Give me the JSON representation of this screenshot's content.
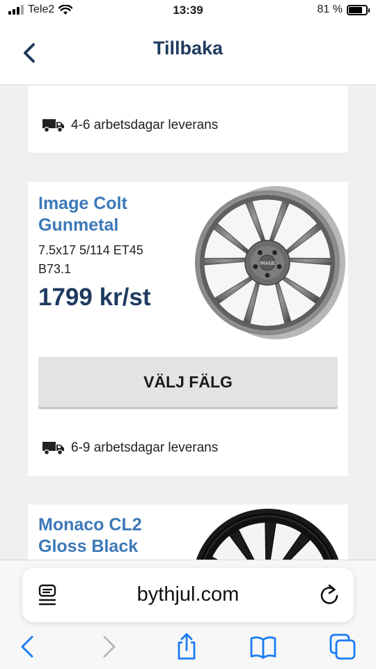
{
  "status_bar": {
    "carrier": "Tele2",
    "time": "13:39",
    "battery": "81 %",
    "battery_level": 0.81
  },
  "nav": {
    "title": "Tillbaka"
  },
  "products": [
    {
      "delivery": "4-6 arbetsdagar leverans"
    },
    {
      "name": "Image Colt Gunmetal",
      "spec": "7.5x17 5/114 ET45 B73.1",
      "price": "1799 kr/st",
      "button": "VÄLJ FÄLG",
      "delivery": "6-9 arbetsdagar leverans",
      "hub_logo": "IMAGE"
    },
    {
      "name": "Monaco CL2 Gloss Black"
    }
  ],
  "browser": {
    "url": "bythjul.com"
  },
  "colors": {
    "accent_blue": "#3b78b8",
    "navy": "#1f3a5f",
    "ios_blue": "#1a7cf2"
  },
  "icons": [
    "signal-icon",
    "wifi-icon",
    "battery-icon",
    "chevron-left-icon",
    "truck-icon",
    "wheel-image",
    "reader-icon",
    "reload-icon",
    "back-icon",
    "forward-icon",
    "share-icon",
    "bookmarks-icon",
    "tabs-icon"
  ]
}
